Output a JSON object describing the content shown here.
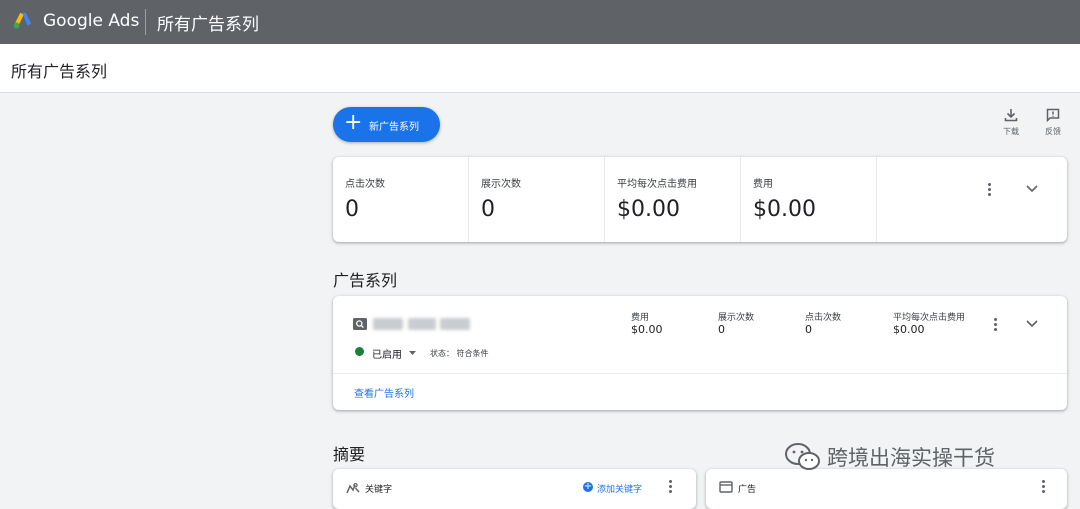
{
  "app": {
    "brand": "Google Ads",
    "page_title": "所有广告系列",
    "sub_title": "所有广告系列"
  },
  "toolbar": {
    "new_campaign_label": "新广告系列",
    "download_label": "下载",
    "feedback_label": "反馈"
  },
  "summary_metrics": [
    {
      "label": "点击次数",
      "value": "0"
    },
    {
      "label": "展示次数",
      "value": "0"
    },
    {
      "label": "平均每次点击费用",
      "value": "$0.00"
    },
    {
      "label": "费用",
      "value": "$0.00"
    }
  ],
  "campaigns_section": {
    "title": "广告系列",
    "campaign": {
      "status": "已启用",
      "status_detail": "状态： 符合条件",
      "status_color": "#188038",
      "stats": [
        {
          "label": "费用",
          "value": "$0.00"
        },
        {
          "label": "展示次数",
          "value": "0"
        },
        {
          "label": "点击次数",
          "value": "0"
        },
        {
          "label": "平均每次点击费用",
          "value": "$0.00"
        }
      ],
      "view_link": "查看广告系列"
    }
  },
  "overview_section": {
    "title": "摘要",
    "keywords_card": {
      "title": "关键字",
      "add_label": "添加关键字"
    },
    "ads_card": {
      "title": "广告"
    }
  },
  "watermark": {
    "text": "跨境出海实操干货"
  },
  "colors": {
    "topbar": "#5f6368",
    "accent": "#1a73e8",
    "background": "#f1f3f4"
  }
}
